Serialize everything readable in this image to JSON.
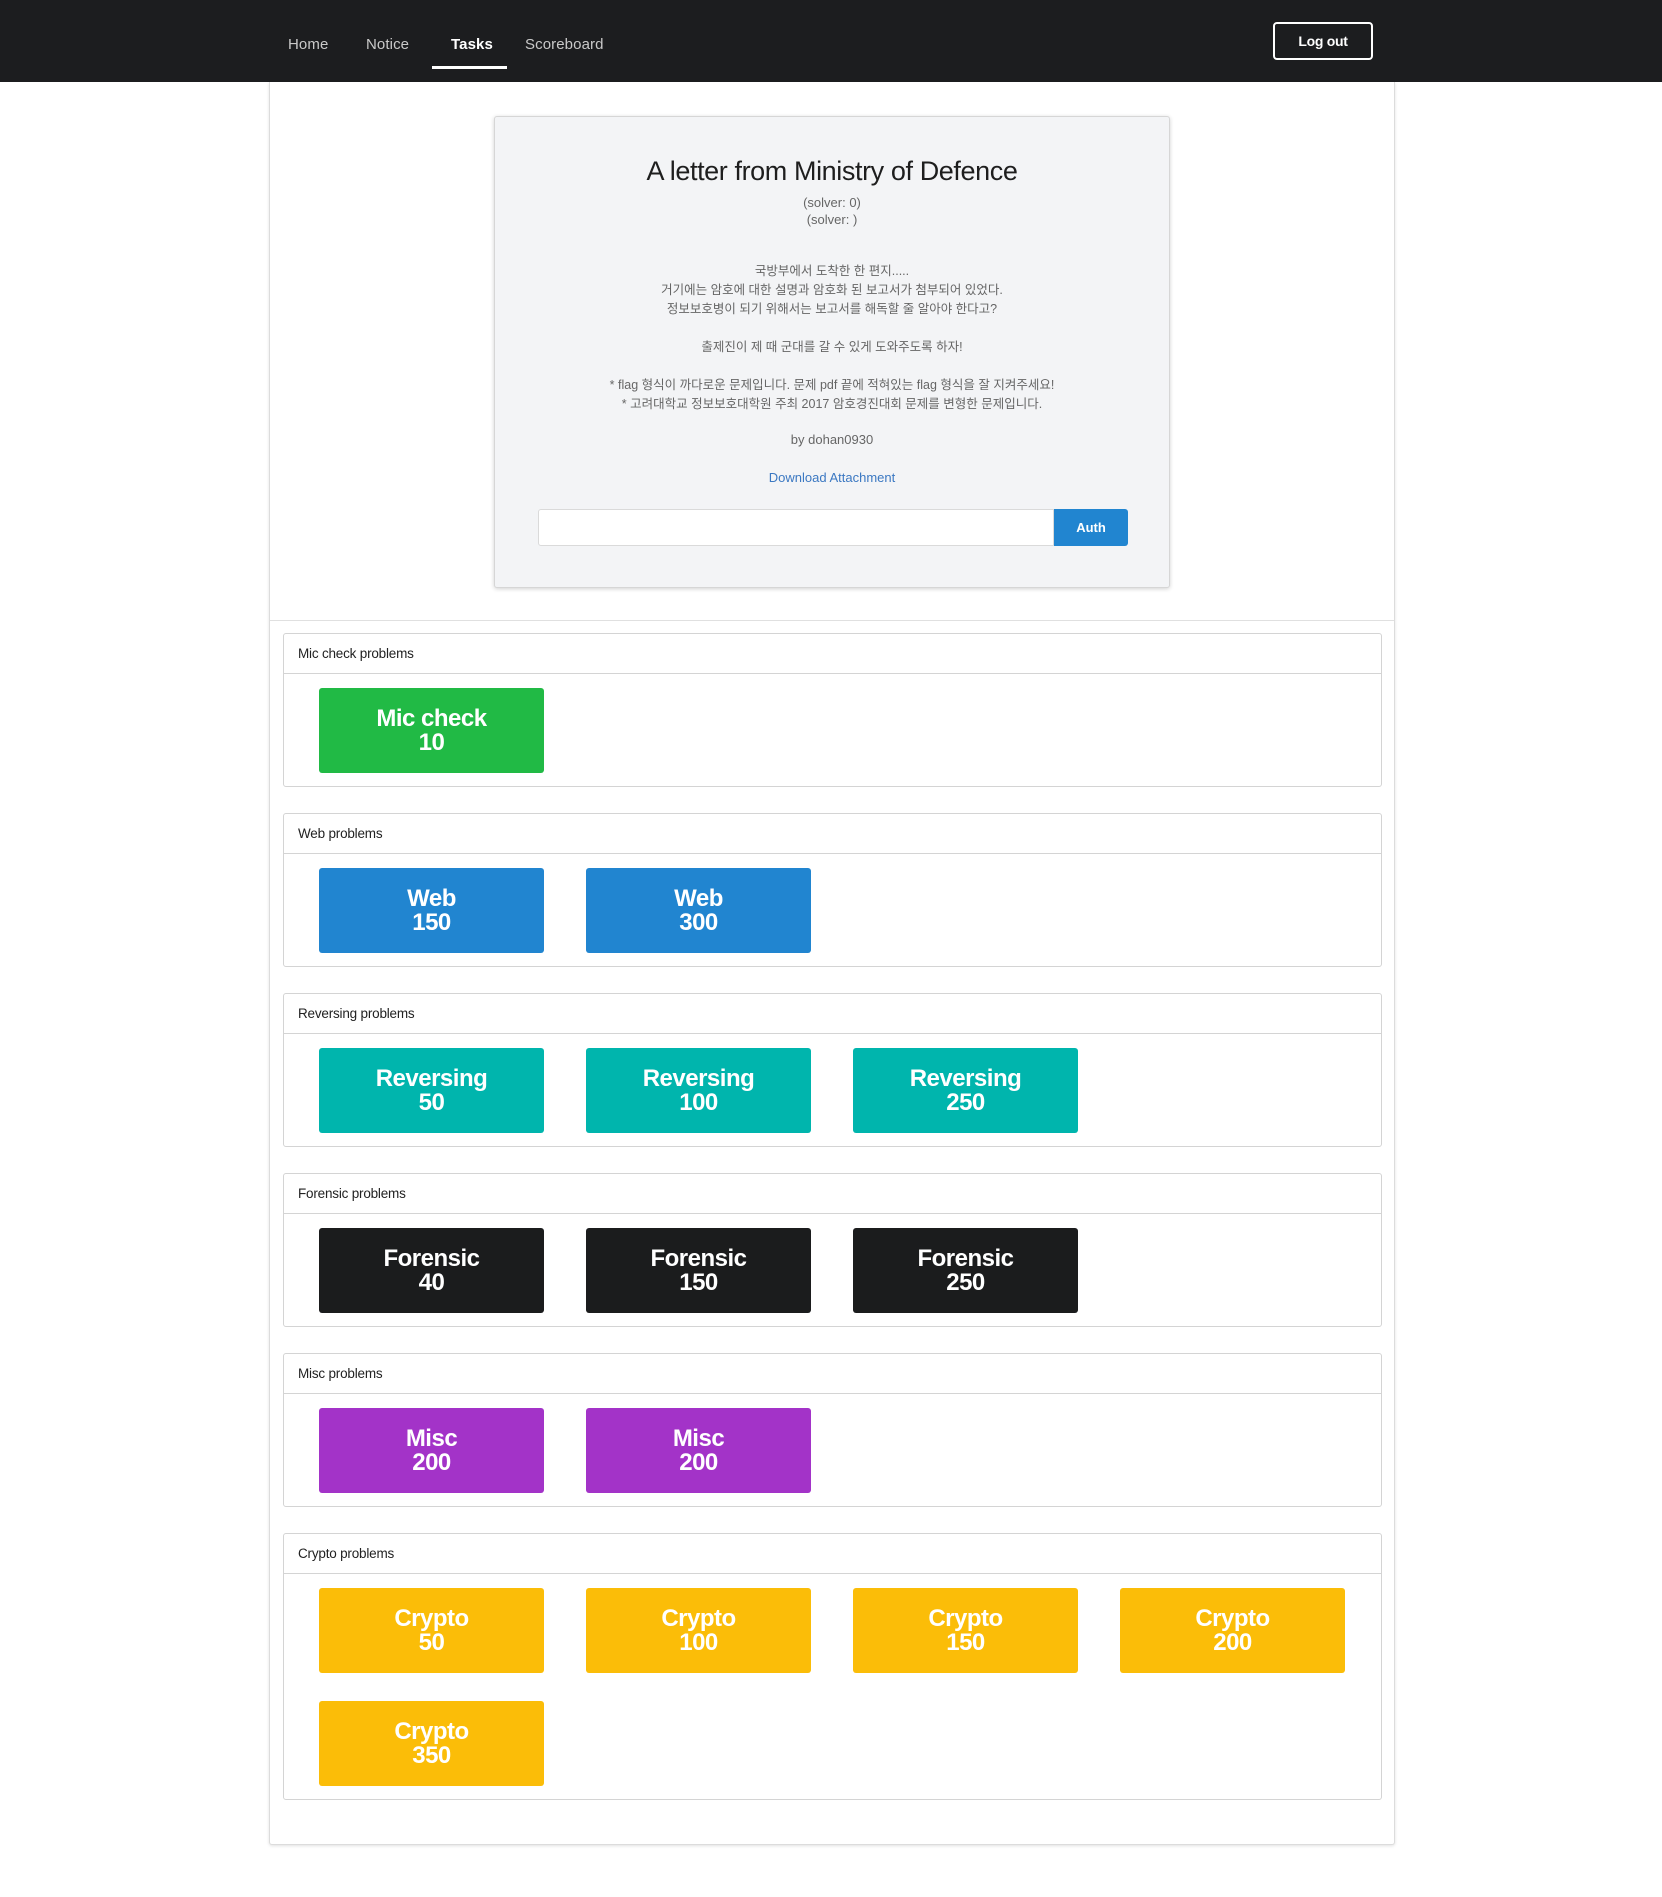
{
  "navbar": {
    "items": [
      {
        "label": "Home",
        "active": false
      },
      {
        "label": "Notice",
        "active": false
      },
      {
        "label": "Tasks",
        "active": true
      },
      {
        "label": "Scoreboard",
        "active": false
      }
    ],
    "logout_label": "Log out"
  },
  "challenge": {
    "title": "A letter from Ministry of Defence",
    "solver_count": "(solver: 0)",
    "solver_list": "(solver: )",
    "description": [
      "국방부에서 도착한 한 편지.....",
      "거기에는 암호에 대한 설명과 암호화 된 보고서가 첨부되어 있었다.",
      "정보보호병이 되기 위해서는 보고서를 해독할 줄 알아야 한다고?",
      "",
      "출제진이 제 때 군대를 갈 수 있게 도와주도록 하자!",
      "",
      "* flag 형식이 까다로운 문제입니다. 문제 pdf 끝에 적혀있는 flag 형식을 잘 지켜주세요!",
      "* 고려대학교 정보보호대학원 주최 2017 암호경진대회 문제를 변형한 문제입니다."
    ],
    "author": "by dohan0930",
    "download_label": "Download Attachment",
    "flag_input_value": "",
    "flag_input_placeholder": "",
    "auth_label": "Auth"
  },
  "categories": [
    {
      "title": "Mic check problems",
      "color": "#21ba45",
      "tasks": [
        {
          "name": "Mic check",
          "points": "10"
        }
      ]
    },
    {
      "title": "Web problems",
      "color": "#2185d0",
      "tasks": [
        {
          "name": "Web",
          "points": "150"
        },
        {
          "name": "Web",
          "points": "300"
        }
      ]
    },
    {
      "title": "Reversing problems",
      "color": "#00b5ad",
      "tasks": [
        {
          "name": "Reversing",
          "points": "50"
        },
        {
          "name": "Reversing",
          "points": "100"
        },
        {
          "name": "Reversing",
          "points": "250"
        }
      ]
    },
    {
      "title": "Forensic problems",
      "color": "#1b1c1d",
      "tasks": [
        {
          "name": "Forensic",
          "points": "40"
        },
        {
          "name": "Forensic",
          "points": "150"
        },
        {
          "name": "Forensic",
          "points": "250"
        }
      ]
    },
    {
      "title": "Misc problems",
      "color": "#a333c8",
      "tasks": [
        {
          "name": "Misc",
          "points": "200"
        },
        {
          "name": "Misc",
          "points": "200"
        }
      ]
    },
    {
      "title": "Crypto problems",
      "color": "#fbbd08",
      "tasks": [
        {
          "name": "Crypto",
          "points": "50"
        },
        {
          "name": "Crypto",
          "points": "100"
        },
        {
          "name": "Crypto",
          "points": "150"
        },
        {
          "name": "Crypto",
          "points": "200"
        },
        {
          "name": "Crypto",
          "points": "350"
        }
      ]
    }
  ]
}
